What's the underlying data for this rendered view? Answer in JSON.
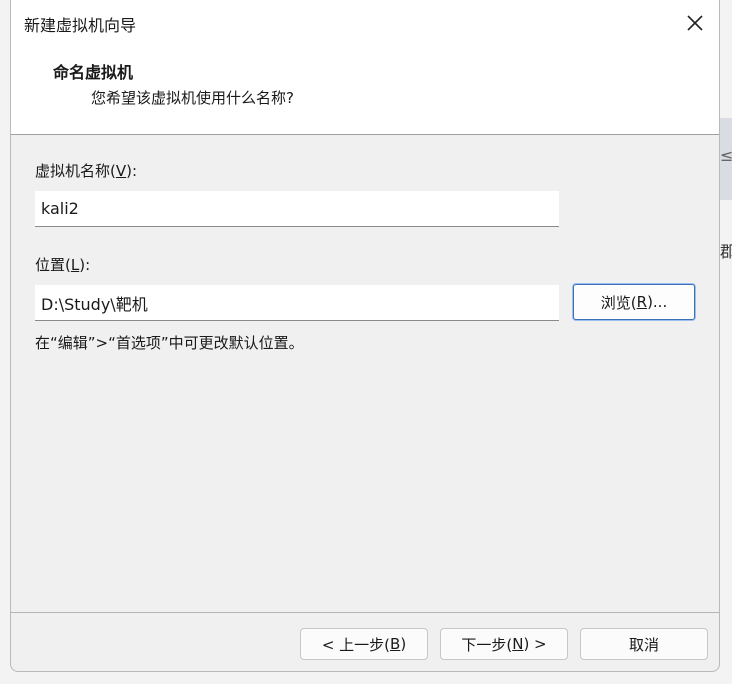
{
  "window": {
    "title": "新建虚拟机向导",
    "close_icon": "close-icon"
  },
  "header": {
    "title": "命名虚拟机",
    "subtitle": "您希望该虚拟机使用什么名称?"
  },
  "form": {
    "name_label_prefix": "虚拟机名称(",
    "name_label_key": "V",
    "name_label_suffix": "):",
    "name_value": "kali2",
    "location_label_prefix": "位置(",
    "location_label_key": "L",
    "location_label_suffix": "):",
    "location_value": "D:\\Study\\靶机",
    "browse_prefix": "浏览(",
    "browse_key": "R",
    "browse_suffix": ")...",
    "hint": "在“编辑”>“首选项”中可更改默认位置。"
  },
  "footer": {
    "back_prefix": "< 上一步(",
    "back_key": "B",
    "back_suffix": ")",
    "next_prefix": "下一步(",
    "next_key": "N",
    "next_suffix": ") >",
    "cancel_label": "取消"
  },
  "background_app": {
    "glyph_top": "≤",
    "glyph_bottom": "郡"
  }
}
